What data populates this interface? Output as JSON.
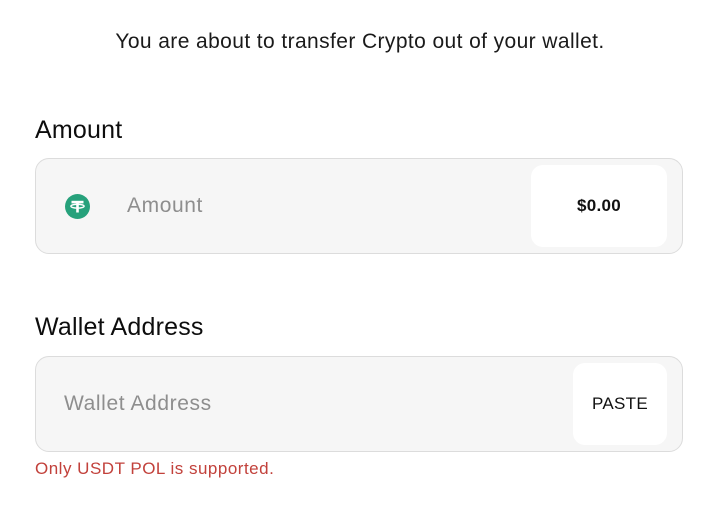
{
  "intro_text": "You are about to transfer Crypto out of your wallet.",
  "amount": {
    "label": "Amount",
    "placeholder": "Amount",
    "value": "",
    "usd_value": "$0.00",
    "token_icon": "tether-usdt-icon",
    "token_color": "#26a17b"
  },
  "wallet": {
    "label": "Wallet Address",
    "placeholder": "Wallet Address",
    "value": "",
    "paste_label": "PASTE"
  },
  "notice": {
    "text": "Only USDT POL is supported.",
    "color": "#c2413b"
  }
}
